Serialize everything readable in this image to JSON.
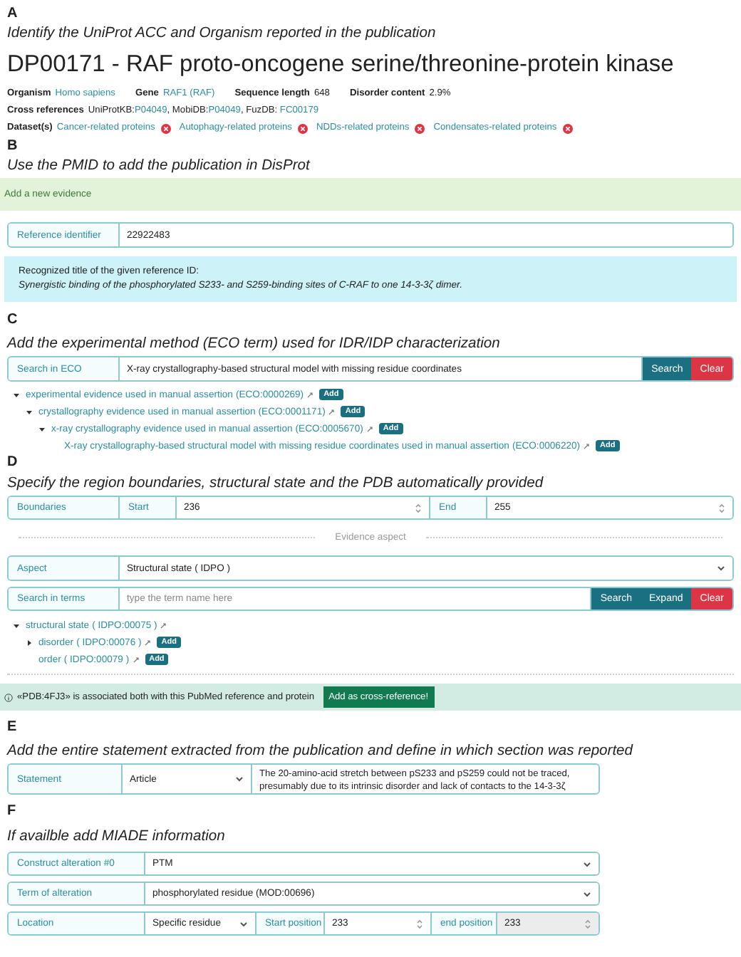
{
  "sectionA": {
    "letter": "A",
    "instruction": "Identify the UniProt ACC and Organism reported in the publication",
    "title": "DP00171 - RAF proto-oncogene serine/threonine-protein kinase",
    "meta": [
      {
        "label": "Organism",
        "value": "Homo sapiens",
        "kind": "link"
      },
      {
        "label": "Gene",
        "value": "RAF1 (RAF)",
        "kind": "link"
      },
      {
        "label": "Sequence length",
        "value": "648",
        "kind": "text"
      },
      {
        "label": "Disorder content",
        "value": "2.9%",
        "kind": "text"
      }
    ],
    "cross_references": {
      "label": "Cross references",
      "items": [
        {
          "prefix": "UniProtKB:",
          "id": "P04049"
        },
        {
          "prefix": ", MobiDB:",
          "id": "P04049"
        },
        {
          "prefix": ", FuzDB: ",
          "id": "FC00179"
        }
      ]
    },
    "datasets": {
      "label": "Dataset(s)",
      "items": [
        {
          "name": "Cancer-related proteins"
        },
        {
          "name": "Autophagy-related proteins"
        },
        {
          "name": "NDDs-related proteins"
        },
        {
          "name": "Condensates-related proteins"
        }
      ]
    }
  },
  "sectionB": {
    "letter": "B",
    "instruction": "Use the PMID to add the publication in DisProt",
    "banner": "Add a new evidence",
    "reference": [
      {
        "kind": "label",
        "text": "Reference identifier"
      },
      {
        "kind": "input",
        "value": "22922483"
      }
    ],
    "recognized": {
      "heading": "Recognized title of the given reference ID:",
      "title": "Synergistic binding of the phosphorylated S233- and S259-binding sites of C-RAF to one 14-3-3ζ dimer."
    }
  },
  "sectionC": {
    "letter": "C",
    "instruction": "Add the experimental method (ECO term) used for IDR/IDP characterization",
    "search": [
      {
        "kind": "label",
        "text": "Search in ECO"
      },
      {
        "kind": "input",
        "value": "X-ray crystallography-based structural model with missing residue coordinates"
      },
      {
        "kind": "button",
        "text": "Search"
      },
      {
        "kind": "dangerbutton",
        "text": "Clear"
      }
    ],
    "tree": [
      {
        "label": "experimental evidence used in manual assertion",
        "code": "(ECO:0000269)",
        "button": "Add",
        "expanded": true,
        "children": [
          {
            "label": "crystallography evidence used in manual assertion",
            "code": "(ECO:0001171)",
            "button": "Add",
            "expanded": true,
            "children": [
              {
                "label": "x-ray crystallography evidence used in manual assertion",
                "code": "(ECO:0005670)",
                "button": "Add",
                "expanded": true,
                "children": [
                  {
                    "label": "X-ray crystallography-based structural model with missing residue coordinates used in manual assertion",
                    "code": "(ECO:0006220)",
                    "button": "Add",
                    "expanded": false
                  }
                ]
              }
            ]
          }
        ]
      }
    ]
  },
  "sectionD": {
    "letter": "D",
    "instruction": "Specify the region boundaries, structural state and the PDB automatically provided",
    "boundaries": [
      {
        "kind": "label",
        "text": "Boundaries"
      },
      {
        "kind": "label",
        "text": "Start"
      },
      {
        "kind": "number",
        "value": "236",
        "disabled": false
      },
      {
        "kind": "label",
        "text": "End"
      },
      {
        "kind": "number",
        "value": "255",
        "disabled": false
      }
    ],
    "divider": "Evidence aspect",
    "aspect": [
      {
        "kind": "label",
        "text": "Aspect"
      },
      {
        "kind": "select",
        "value": "Structural state ( IDPO )"
      }
    ],
    "term_search": [
      {
        "kind": "label",
        "text": "Search in terms"
      },
      {
        "kind": "input",
        "placeholder": "type the term name here"
      },
      {
        "kind": "button",
        "text": "Search"
      },
      {
        "kind": "button",
        "text": "Expand"
      },
      {
        "kind": "dangerbutton",
        "text": "Clear"
      }
    ],
    "tree": [
      {
        "label": "structural state",
        "code": "( IDPO:00075 )",
        "expanded": true,
        "children": [
          {
            "label": "disorder",
            "code": "( IDPO:00076 )",
            "button": "Add",
            "expanded": false,
            "collapsed_children": true
          },
          {
            "label": "order",
            "code": "( IDPO:00079 )",
            "button": "Add",
            "expanded": false
          }
        ]
      }
    ],
    "pdb_notice": {
      "text": "«PDB:4FJ3» is associated both with this PubMed reference and protein",
      "button": "Add as cross-reference!"
    }
  },
  "sectionE": {
    "letter": "E",
    "instruction": "Add the entire statement extracted from the publication and define in which section was reported",
    "statement": [
      {
        "kind": "label",
        "text": "Statement"
      },
      {
        "kind": "select",
        "value": "Article"
      },
      {
        "kind": "textarea",
        "value": "The 20-amino-acid stretch between pS233 and pS259 could not be traced, presumably due to its intrinsic disorder and lack of contacts to the 14-3-3ζ"
      }
    ]
  },
  "sectionF": {
    "letter": "F",
    "instruction": "If availble add MIADE information",
    "rows": [
      [
        {
          "kind": "label",
          "text": "Construct alteration #0"
        },
        {
          "kind": "select",
          "value": "PTM"
        }
      ],
      [
        {
          "kind": "label",
          "text": "Term of alteration"
        },
        {
          "kind": "select",
          "value": "phosphorylated residue (MOD:00696)"
        }
      ],
      [
        {
          "kind": "label",
          "text": "Location"
        },
        {
          "kind": "select",
          "value": "Specific residue"
        },
        {
          "kind": "label",
          "text": "Start position"
        },
        {
          "kind": "number",
          "value": "233",
          "disabled": false
        },
        {
          "kind": "label",
          "text": "end position"
        },
        {
          "kind": "number",
          "value": "233",
          "disabled": true
        }
      ]
    ]
  }
}
